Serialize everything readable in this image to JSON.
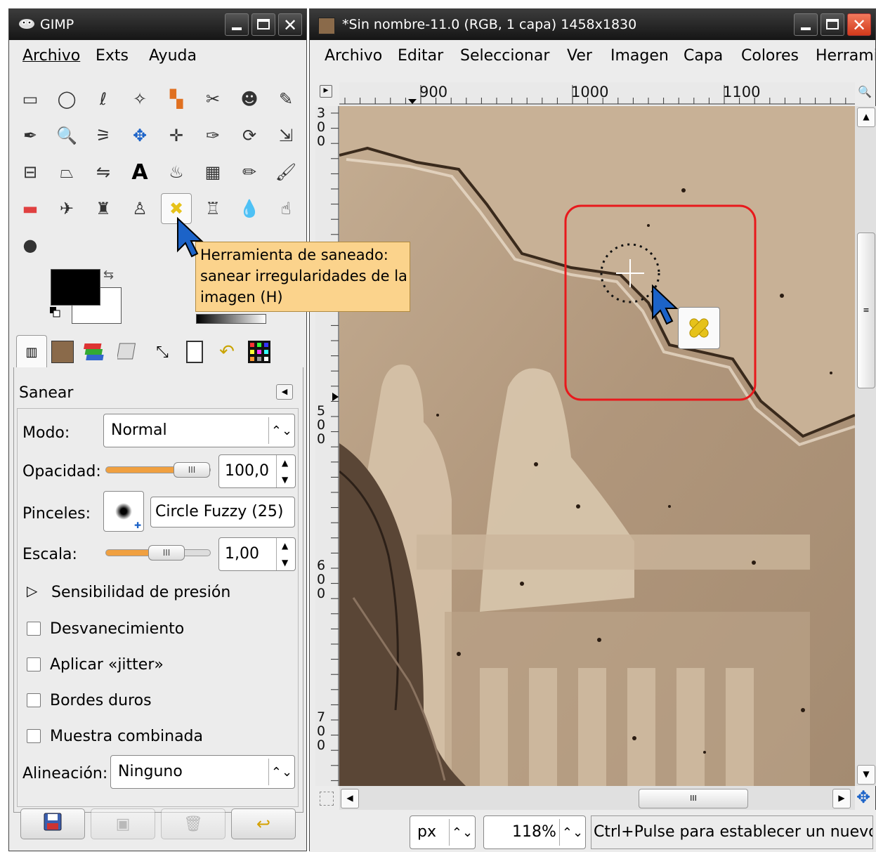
{
  "toolbox": {
    "title": "GIMP",
    "menu": [
      "Archivo",
      "Exts",
      "Ayuda"
    ],
    "tools": [
      "rect-select-icon",
      "ellipse-select-icon",
      "free-select-icon",
      "fuzzy-select-icon",
      "color-select-icon",
      "scissors-icon",
      "foreground-select-icon",
      "paths-icon",
      "color-picker-icon",
      "zoom-icon",
      "measure-icon",
      "move-icon",
      "align-icon",
      "crop-icon",
      "rotate-icon",
      "scale-icon",
      "shear-icon",
      "perspective-icon",
      "flip-icon",
      "text-icon",
      "bucket-fill-icon",
      "blend-icon",
      "pencil-icon",
      "paintbrush-icon",
      "eraser-icon",
      "airbrush-icon",
      "ink-icon",
      "clone-icon",
      "heal-icon",
      "perspective-clone-icon",
      "blur-icon",
      "smudge-icon",
      "dodge-burn-icon"
    ],
    "active_tool": "heal-icon",
    "tooltip": [
      "Herramienta de saneado:",
      "sanear irregularidades de la",
      "imagen  (H)"
    ],
    "fg_color": "#000000",
    "bg_color": "#ffffff"
  },
  "options": {
    "title": "Sanear",
    "mode_label": "Modo:",
    "mode_value": "Normal",
    "opacity_label": "Opacidad:",
    "opacity_value": "100,0",
    "opacity_fraction": 1.0,
    "brush_label": "Pinceles:",
    "brush_value": "Circle Fuzzy (25)",
    "scale_label": "Escala:",
    "scale_value": "1,00",
    "pressure_label": "Sensibilidad de presión",
    "checkboxes": [
      "Desvanecimiento",
      "Aplicar «jitter»",
      "Bordes duros",
      "Muestra combinada"
    ],
    "align_label": "Alineación:",
    "align_value": "Ninguno"
  },
  "image_window": {
    "title": "*Sin nombre-11.0 (RGB, 1 capa) 1458x1830",
    "menu": [
      "Archivo",
      "Editar",
      "Seleccionar",
      "Ver",
      "Imagen",
      "Capa",
      "Colores",
      "Herrami"
    ],
    "ruler_h": [
      "900",
      "1000",
      "1100"
    ],
    "ruler_v": [
      "500",
      "500",
      "600",
      "700"
    ],
    "unit": "px",
    "zoom": "118%",
    "status": "Ctrl+Pulse para establecer un nuevo..."
  }
}
